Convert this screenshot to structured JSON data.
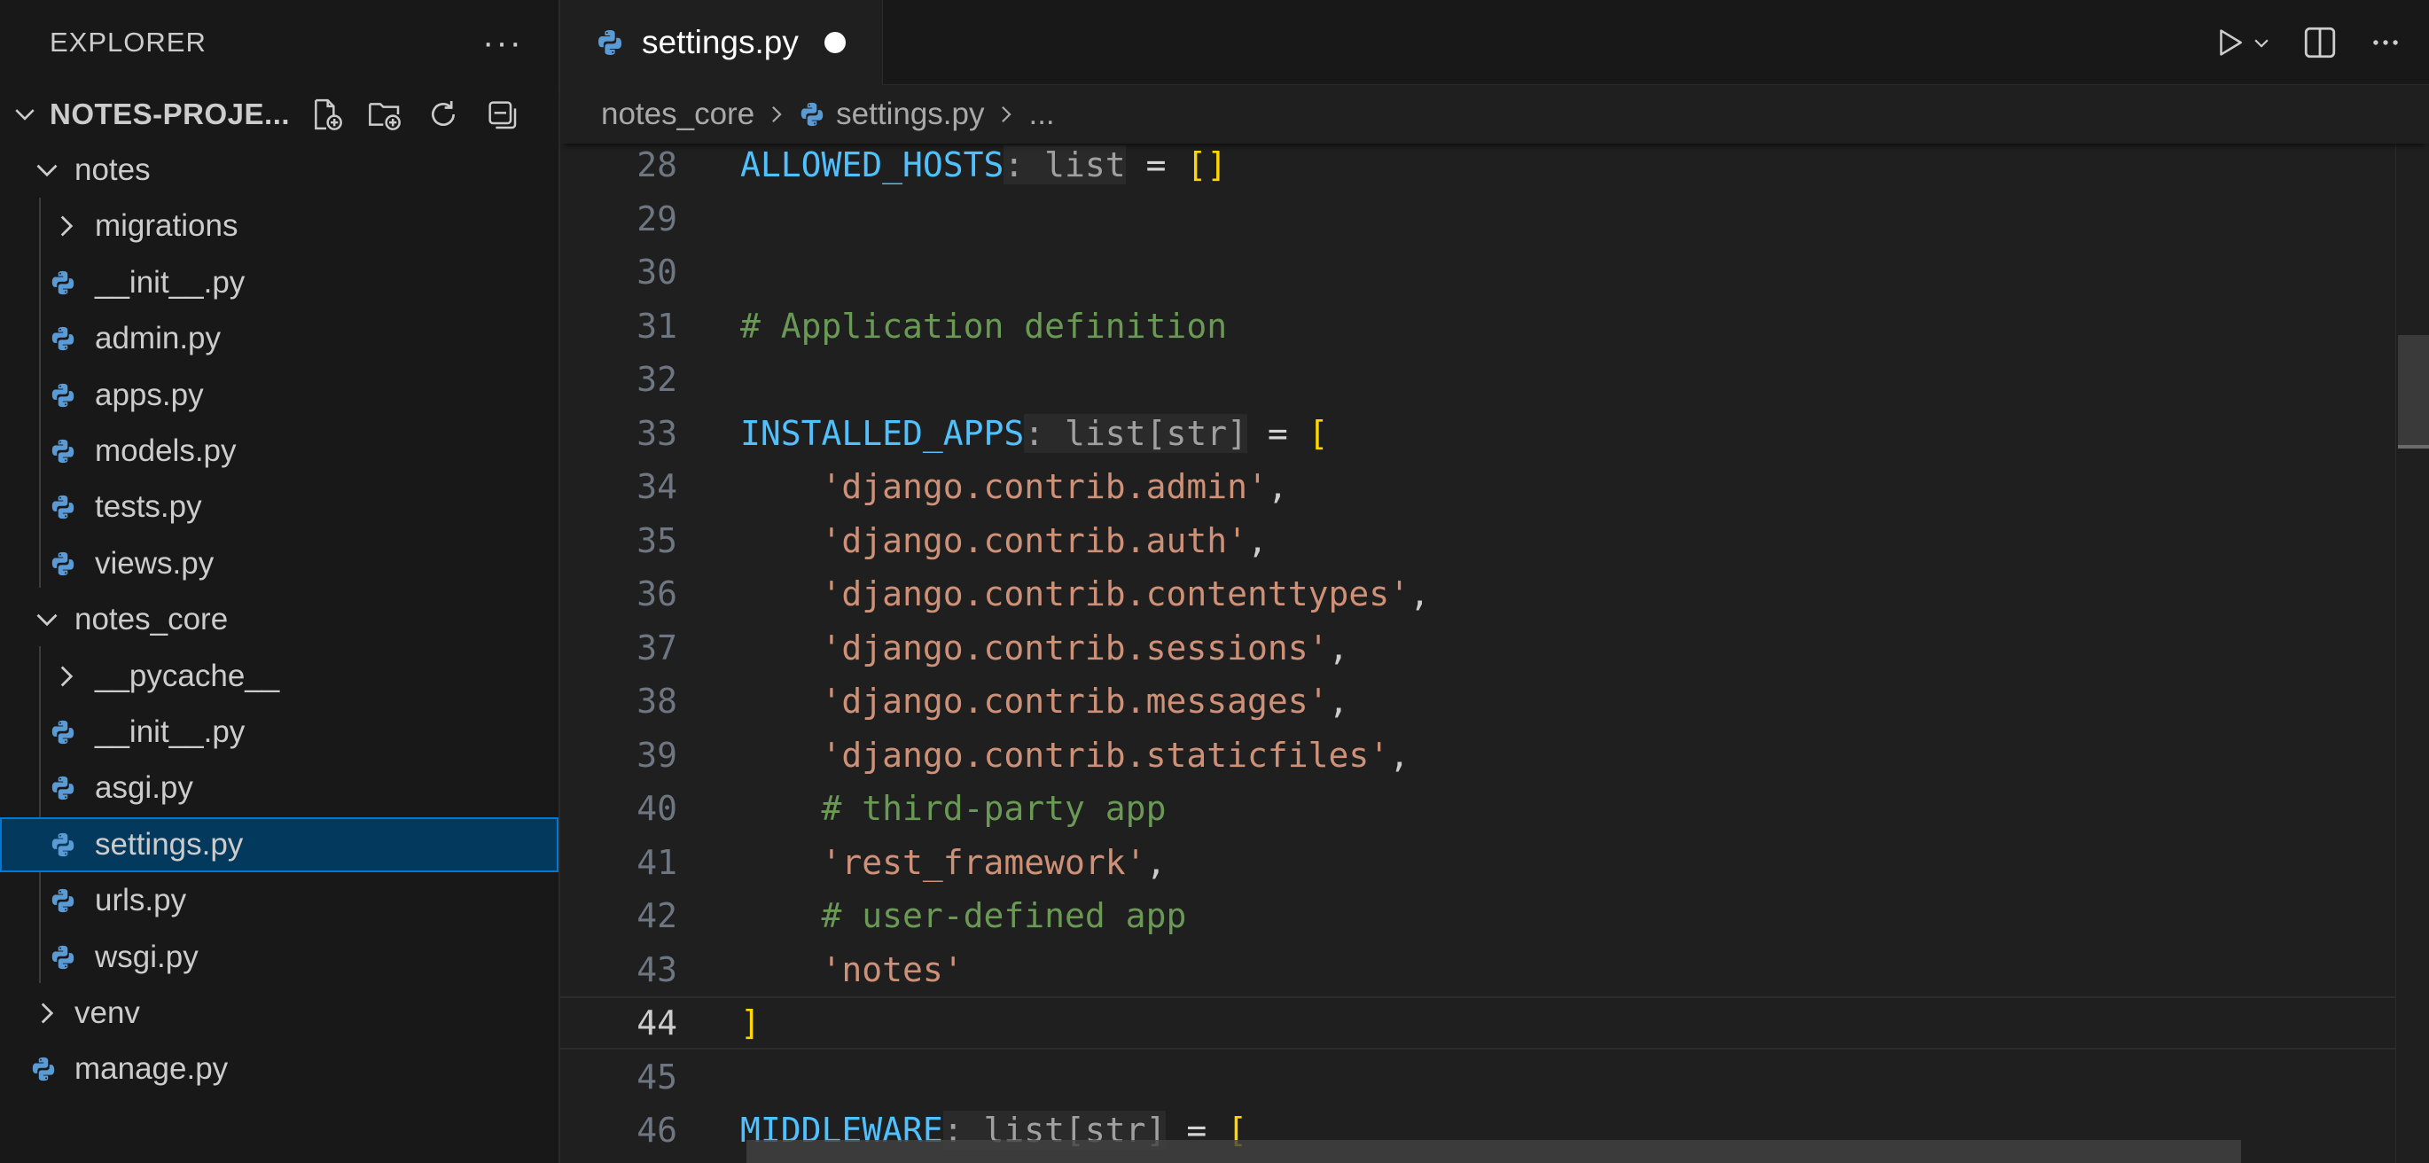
{
  "sidebar": {
    "title": "EXPLORER",
    "more_label": "···",
    "project": {
      "name": "NOTES-PROJE...",
      "actions": [
        "new-file-icon",
        "new-folder-icon",
        "refresh-icon",
        "collapse-all-icon"
      ]
    },
    "tree": [
      {
        "label": "notes",
        "kind": "folder-open"
      },
      {
        "label": "migrations",
        "kind": "folder-closed"
      },
      {
        "label": "__init__.py",
        "kind": "python-file"
      },
      {
        "label": "admin.py",
        "kind": "python-file"
      },
      {
        "label": "apps.py",
        "kind": "python-file"
      },
      {
        "label": "models.py",
        "kind": "python-file"
      },
      {
        "label": "tests.py",
        "kind": "python-file"
      },
      {
        "label": "views.py",
        "kind": "python-file"
      },
      {
        "label": "notes_core",
        "kind": "folder-open"
      },
      {
        "label": "__pycache__",
        "kind": "folder-closed"
      },
      {
        "label": "__init__.py",
        "kind": "python-file"
      },
      {
        "label": "asgi.py",
        "kind": "python-file"
      },
      {
        "label": "settings.py",
        "kind": "python-file",
        "selected": true
      },
      {
        "label": "urls.py",
        "kind": "python-file"
      },
      {
        "label": "wsgi.py",
        "kind": "python-file"
      },
      {
        "label": "venv",
        "kind": "folder-closed"
      },
      {
        "label": "manage.py",
        "kind": "python-file"
      }
    ]
  },
  "editor": {
    "tab": {
      "label": "settings.py",
      "dirty": true
    },
    "actions": [
      "run-icon",
      "run-dropdown-icon",
      "split-editor-icon",
      "more-actions-icon"
    ],
    "breadcrumb": {
      "folder": "notes_core",
      "file": "settings.py",
      "symbol": "..."
    },
    "current_line": "44",
    "lines": [
      {
        "n": "28",
        "code": "ALLOWED_HOSTS: list = []"
      },
      {
        "n": "29",
        "code": ""
      },
      {
        "n": "30",
        "code": ""
      },
      {
        "n": "31",
        "code": "# Application definition"
      },
      {
        "n": "32",
        "code": ""
      },
      {
        "n": "33",
        "code": "INSTALLED_APPS: list[str] = ["
      },
      {
        "n": "34",
        "code": "    'django.contrib.admin',"
      },
      {
        "n": "35",
        "code": "    'django.contrib.auth',"
      },
      {
        "n": "36",
        "code": "    'django.contrib.contenttypes',"
      },
      {
        "n": "37",
        "code": "    'django.contrib.sessions',"
      },
      {
        "n": "38",
        "code": "    'django.contrib.messages',"
      },
      {
        "n": "39",
        "code": "    'django.contrib.staticfiles',"
      },
      {
        "n": "40",
        "code": "    # third-party app"
      },
      {
        "n": "41",
        "code": "    'rest_framework',"
      },
      {
        "n": "42",
        "code": "    # user-defined app"
      },
      {
        "n": "43",
        "code": "    'notes'"
      },
      {
        "n": "44",
        "code": "]"
      },
      {
        "n": "45",
        "code": ""
      },
      {
        "n": "46",
        "code": "MIDDLEWARE: list[str] = ["
      }
    ]
  },
  "colors": {
    "sidebar_bg": "#181818",
    "editor_bg": "#1f1f1f",
    "selection_bg": "#04395e",
    "selection_border": "#0078d4",
    "python_icon": "#5b9bd5",
    "variable": "#4fc1ff",
    "string": "#ce9178",
    "comment": "#6a9955",
    "bracket": "#ffd700"
  }
}
